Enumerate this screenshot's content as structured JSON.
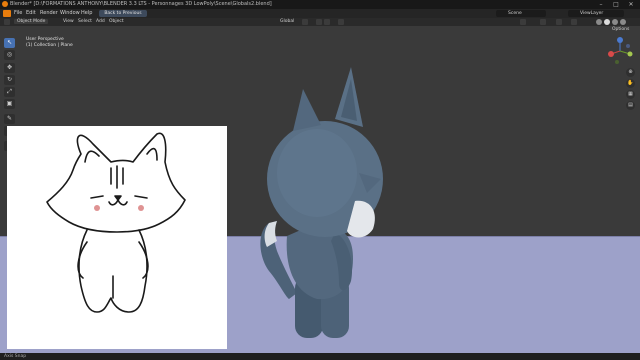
{
  "window": {
    "title": "Blender* [D:\\FORMATIONS ANTHONY\\BLENDER 3.3 LTS - Personnages 3D LowPoly\\Scene\\Globals2.blend]",
    "controls": [
      "–",
      "□",
      "✕"
    ]
  },
  "menubar": {
    "items": [
      "File",
      "Edit",
      "Render",
      "Window",
      "Help"
    ],
    "back_button": "Back to Previous",
    "scene_label": "Scene",
    "viewlayer_label": "ViewLayer"
  },
  "header3d": {
    "mode": "Object Mode",
    "menus": [
      "View",
      "Select",
      "Add",
      "Object"
    ],
    "transform_orientation": "Global",
    "options_label": "Options"
  },
  "viewport": {
    "view_name": "User Perspective",
    "collection_info": "(1) Collection | Plane"
  },
  "tools": [
    "↖",
    "◎",
    "✥",
    "↻",
    "⤢",
    "▣",
    "✎",
    "◢",
    "▢"
  ],
  "navigation": [
    "⊕",
    "✋",
    "▦",
    "▤"
  ],
  "statusbar": {
    "text": "Axis Snap"
  },
  "colors": {
    "floor": "#9da1c9",
    "viewport_bg": "#3a3a3a",
    "character_body": "#4d6278",
    "accent_blue": "#4772b3"
  }
}
